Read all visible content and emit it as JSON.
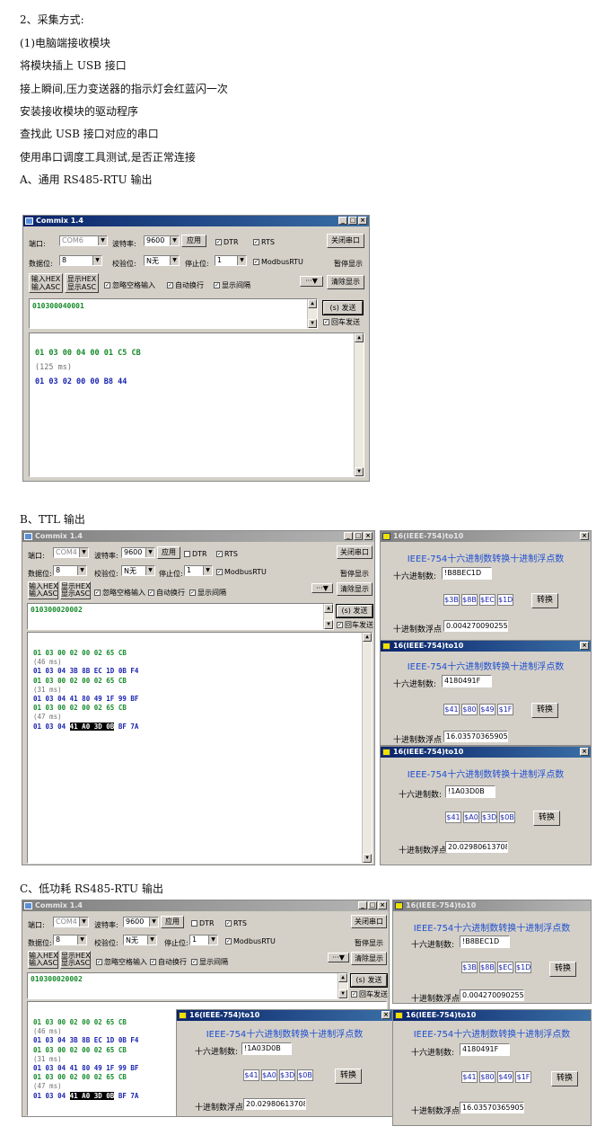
{
  "doc": {
    "lines": [
      "2、采集方式:",
      "(1)电脑端接收模块",
      "将模块插上 USB 接口",
      "接上瞬间,压力变送器的指示灯会红蓝闪一次",
      "安装接收模块的驱动程序",
      "查找此 USB 接口对应的串口",
      "使用串口调度工具测试,是否正常连接",
      "A、通用 RS485-RTU 输出"
    ],
    "section_b": "B、TTL 输出",
    "section_c": "C、低功耗 RS485-RTU 输出"
  },
  "commix": {
    "title": "Commix 1.4",
    "min": "_",
    "max": "□",
    "close": "×",
    "port_label": "端口:",
    "baud_label": "波特率:",
    "apply": "应用",
    "dtr": "DTR",
    "rts": "RTS",
    "close_port": "关闭串口",
    "data_bits_label": "数据位:",
    "data_bits": "8",
    "parity_label": "校验位:",
    "parity": "N无",
    "stop_label": "停止位:",
    "stop": "1",
    "modbus": "ModbusRTU",
    "pause": "暂停显示",
    "in_hex": "输入HEX",
    "in_asc": "输入ASC",
    "show_hex": "显示HEX",
    "show_asc": "显示ASC",
    "ignore_space": "忽略空格输入",
    "auto_wrap": "自动换行",
    "show_interval": "显示间隔",
    "more": "···▼",
    "clear": "清除显示",
    "send": "(s) 发送",
    "enter_send": "回车发送",
    "enter_send_short": "回车发送"
  },
  "win_a": {
    "port": "COM6",
    "baud": "9600",
    "input": "010300040001",
    "rx": [
      {
        "t": "01 03 00 04 00 01 C5 CB",
        "c": "g"
      },
      {
        "t": "(125 ms)",
        "c": "gr"
      },
      {
        "t": "01 03 02 00 00 B8 44",
        "c": "b"
      }
    ]
  },
  "win_b": {
    "port": "COM4",
    "baud": "9600",
    "input": "010300020002",
    "rx": [
      {
        "t": "01 03 00 02 00 02 65 CB",
        "c": "g"
      },
      {
        "t": "(46 ms)",
        "c": "gr"
      },
      {
        "t": "01 03 04 3B 8B EC 1D 0B F4",
        "c": "b"
      },
      {
        "t": "01 03 00 02 00 02 65 CB",
        "c": "g"
      },
      {
        "t": "(31 ms)",
        "c": "gr"
      },
      {
        "t": "01 03 04 41 80 49 1F 99 BF",
        "c": "b"
      },
      {
        "t": "01 03 00 02 00 02 65 CB",
        "c": "g"
      },
      {
        "t": "(47 ms)",
        "c": "gr"
      }
    ],
    "last_prefix": "01 03 04 ",
    "last_hl": "41 A0 3D 0B",
    "last_suffix": " BF 7A"
  },
  "converter": {
    "title": "16(IEEE-754)to10",
    "heading": "IEEE-754十六进制数转换十进制浮点数",
    "hex_label": "十六进制数:",
    "float_label": "十进制数浮点",
    "convert": "转换"
  },
  "conv1": {
    "hex": "!B8BEC1D",
    "b1": "$3B",
    "b2": "$8B",
    "b3": "$EC",
    "b4": "$1D",
    "result": "0.00427009025588632"
  },
  "conv2": {
    "hex": "4180491F",
    "b1": "$41",
    "b2": "$80",
    "b3": "$49",
    "b4": "$1F",
    "result": "16.0357036590576"
  },
  "conv3": {
    "hex": "!1A03D0B",
    "b1": "$41",
    "b2": "$A0",
    "b3": "$3D",
    "b4": "$0B",
    "result": "20.029806137085"
  }
}
